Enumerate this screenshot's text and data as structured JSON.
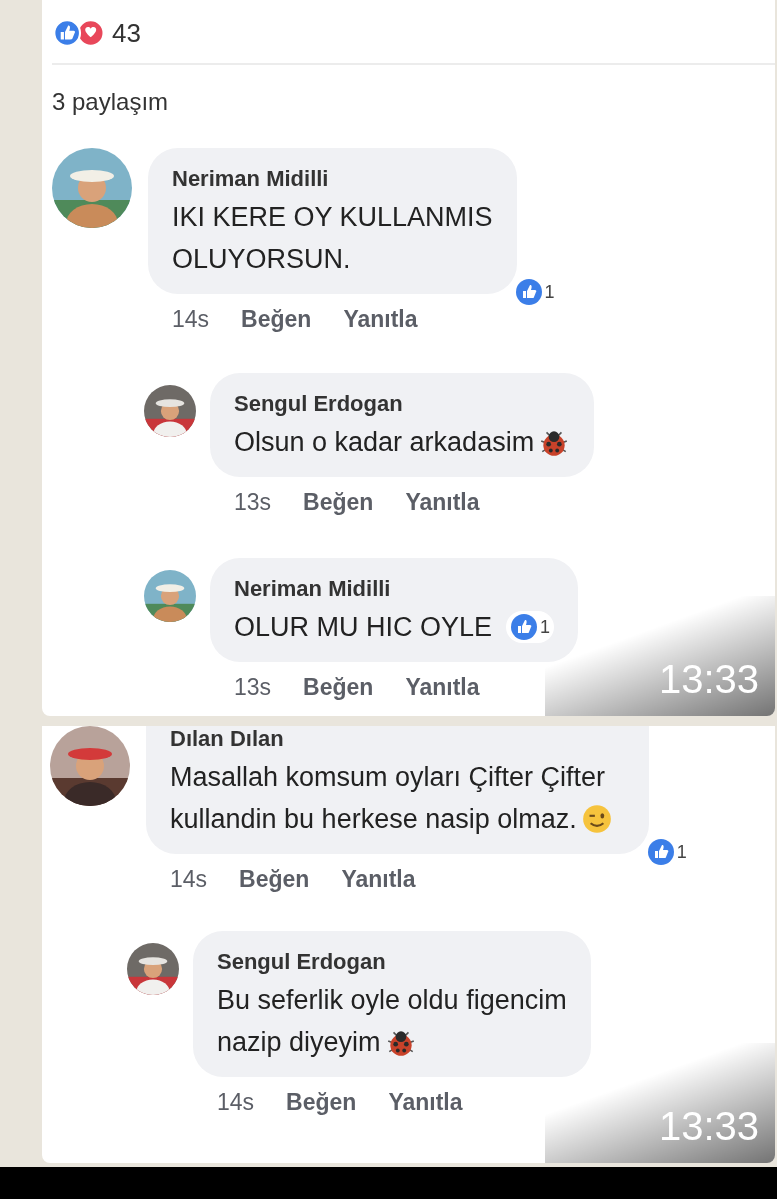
{
  "screenshots": [
    {
      "reactions": {
        "count": "43"
      },
      "shares": "3 paylaşım",
      "time": "13:33",
      "comments": [
        {
          "kind": "comment",
          "author": "Neriman Midilli",
          "lines": [
            [
              {
                "kind": "text",
                "text": "IKI KERE OY KULLANMIS"
              }
            ],
            [
              {
                "kind": "text",
                "text": "OLUYORSUN."
              }
            ]
          ],
          "likes": "1",
          "age": "14s",
          "like_action": "Beğen",
          "reply_action": "Yanıtla"
        },
        {
          "kind": "reply",
          "author": "Sengul Erdogan",
          "lines": [
            [
              {
                "kind": "text",
                "text": "Olsun o kadar arkadasim"
              },
              {
                "kind": "ladybug"
              }
            ]
          ],
          "age": "13s",
          "like_action": "Beğen",
          "reply_action": "Yanıtla"
        },
        {
          "kind": "reply",
          "author": "Neriman Midilli",
          "lines": [
            [
              {
                "kind": "text",
                "text": "OLUR MU HIC OYLE"
              }
            ]
          ],
          "likes": "1",
          "age": "13s",
          "like_action": "Beğen",
          "reply_action": "Yanıtla"
        }
      ]
    },
    {
      "time": "13:33",
      "comments": [
        {
          "kind": "comment",
          "author": "Dılan Dılan",
          "lines": [
            [
              {
                "kind": "text",
                "text": "Masallah komsum oyları Çifter Çifter"
              }
            ],
            [
              {
                "kind": "text",
                "text": "kullandin bu herkese nasip olmaz."
              },
              {
                "kind": "wink"
              }
            ]
          ],
          "likes": "1",
          "age": "14s",
          "like_action": "Beğen",
          "reply_action": "Yanıtla"
        },
        {
          "kind": "reply",
          "author": "Sengul Erdogan",
          "lines": [
            [
              {
                "kind": "text",
                "text": "Bu seferlik oyle oldu figencim"
              }
            ],
            [
              {
                "kind": "text",
                "text": "nazip diyeyim"
              },
              {
                "kind": "ladybug"
              }
            ]
          ],
          "age": "14s",
          "like_action": "Beğen",
          "reply_action": "Yanıtla"
        }
      ]
    }
  ]
}
